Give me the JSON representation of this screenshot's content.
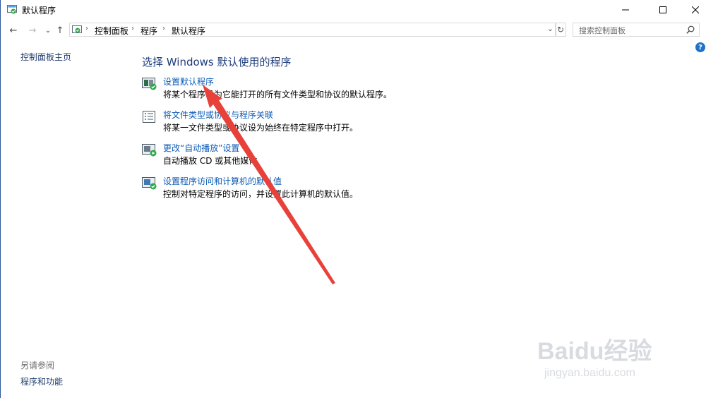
{
  "window": {
    "title": "默认程序",
    "icon": "default-programs-icon"
  },
  "nav": {
    "back": "←",
    "forward": "→",
    "recent": "⌄",
    "up": "↑",
    "breadcrumb": [
      "控制面板",
      "程序",
      "默认程序"
    ],
    "search_placeholder": "搜索控制面板",
    "help_label": "?"
  },
  "left": {
    "home_link": "控制面板主页",
    "see_also_label": "另请参阅",
    "see_also_link": "程序和功能"
  },
  "main": {
    "heading": "选择 Windows 默认使用的程序",
    "items": [
      {
        "link": "设置默认程序",
        "desc": "将某个程序设为它能打开的所有文件类型和协议的默认程序。",
        "icon": "set-default-programs-icon"
      },
      {
        "link": "将文件类型或协议与程序关联",
        "desc": "将某一文件类型或协议设为始终在特定程序中打开。",
        "icon": "file-association-icon"
      },
      {
        "link": "更改“自动播放”设置",
        "desc": "自动播放 CD 或其他媒体",
        "icon": "autoplay-icon"
      },
      {
        "link": "设置程序访问和计算机的默认值",
        "desc": "控制对特定程序的访问，并设置此计算机的默认值。",
        "icon": "program-access-icon"
      }
    ]
  },
  "watermark": {
    "logo": "Baidu经验",
    "url": "jingyan.baidu.com"
  },
  "colors": {
    "link": "#0b5bb5",
    "heading": "#1e3d7b",
    "arrow": "#e8413a",
    "help": "#1e73c8"
  }
}
